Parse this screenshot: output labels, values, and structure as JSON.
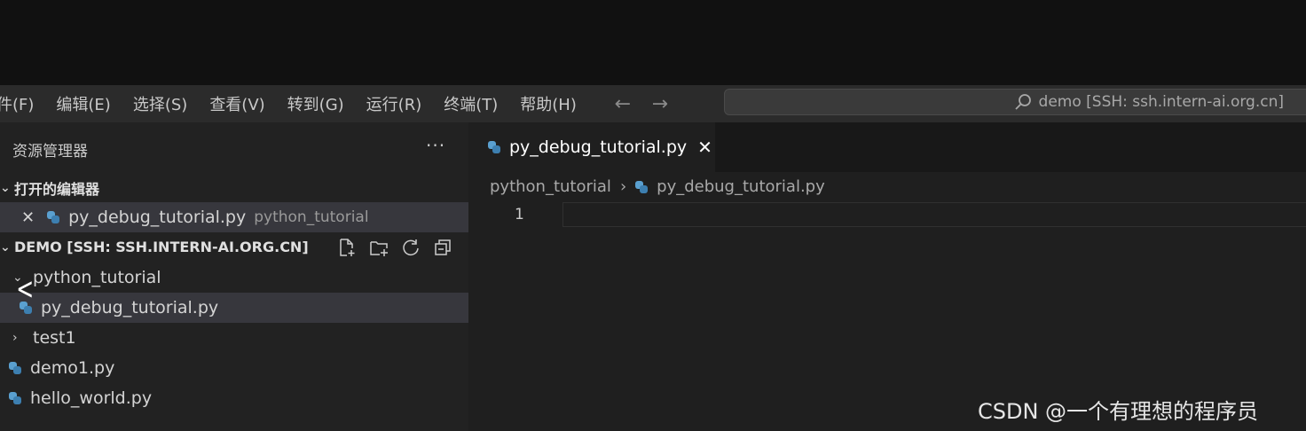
{
  "menubar": {
    "items": [
      "件(F)",
      "编辑(E)",
      "选择(S)",
      "查看(V)",
      "转到(G)",
      "运行(R)",
      "终端(T)",
      "帮助(H)"
    ],
    "back_icon": "arrow-left-icon",
    "forward_icon": "arrow-right-icon",
    "search_text": "demo [SSH: ssh.intern-ai.org.cn]"
  },
  "sidebar": {
    "header": "资源管理器",
    "more": "···",
    "open_editors": {
      "title": "打开的编辑器",
      "items": [
        {
          "name": "py_debug_tutorial.py",
          "folder": "python_tutorial"
        }
      ]
    },
    "workspace": {
      "title": "DEMO [SSH: SSH.INTERN-AI.ORG.CN]",
      "tree": {
        "folder1": "python_tutorial",
        "file1": "py_debug_tutorial.py",
        "folder2": "test1",
        "file2": "demo1.py",
        "file3": "hello_world.py"
      }
    }
  },
  "editor": {
    "tab_label": "py_debug_tutorial.py",
    "tab_close": "✕",
    "breadcrumb": [
      "python_tutorial",
      "py_debug_tutorial.py"
    ],
    "line_number": "1"
  },
  "watermark": "CSDN @一个有理想的程序员"
}
